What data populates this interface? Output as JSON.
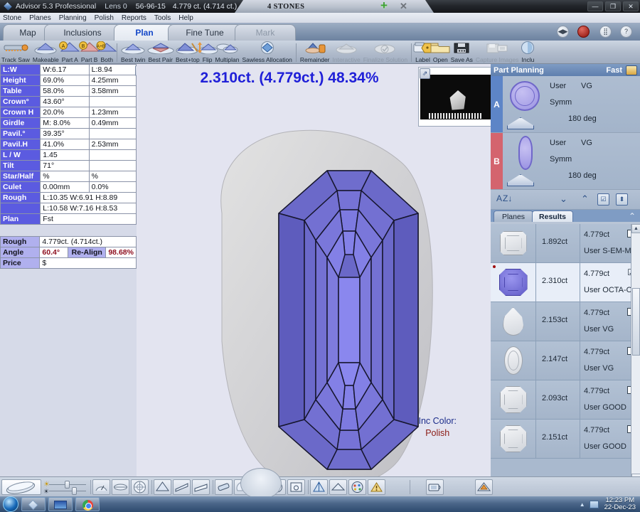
{
  "window": {
    "app_title": "Advisor 5.3 Professional",
    "lens": "Lens 0",
    "serial": "56-96-15",
    "carat_summary": "4.779 ct. (4.714 ct.)",
    "stone_tab": "4 STONES",
    "add_icon": "plus-icon",
    "close_tab_icon": "close-icon",
    "minimize": "—",
    "maximize": "❐",
    "close": "✕"
  },
  "menu": [
    "Stone",
    "Planes",
    "Planning",
    "Polish",
    "Reports",
    "Tools",
    "Help"
  ],
  "tabs": [
    {
      "label": "Map",
      "active": false,
      "dim": false
    },
    {
      "label": "Inclusions",
      "active": false,
      "dim": false
    },
    {
      "label": "Plan",
      "active": true,
      "dim": false
    },
    {
      "label": "Fine Tune",
      "active": false,
      "dim": false
    },
    {
      "label": "Mark",
      "active": false,
      "dim": true
    }
  ],
  "tabstrip_buttons": [
    {
      "name": "nav-left-right-button",
      "glyph": "◀▶"
    },
    {
      "name": "record-button",
      "glyph": ""
    },
    {
      "name": "grid-view-button",
      "glyph": "⣿"
    },
    {
      "name": "help-button",
      "glyph": "?"
    }
  ],
  "toolbar": [
    {
      "label": "Track Saw",
      "icon": "saw-icon",
      "disabled": false
    },
    {
      "label": "Makeable",
      "icon": "makeable-icon",
      "disabled": false
    },
    {
      "label": "Part A",
      "icon": "part-a-icon",
      "disabled": false
    },
    {
      "label": "Part B",
      "icon": "part-b-icon",
      "disabled": false
    },
    {
      "label": "Both",
      "icon": "both-icon",
      "disabled": false
    },
    {
      "label": "Best twin",
      "icon": "best-twin-icon",
      "disabled": false
    },
    {
      "label": "Best Pair",
      "icon": "best-pair-icon",
      "disabled": false
    },
    {
      "label": "Best+top",
      "icon": "best-top-icon",
      "disabled": false
    },
    {
      "label": "Flip",
      "icon": "flip-icon",
      "disabled": false
    },
    {
      "label": "Multiplan",
      "icon": "multiplan-icon",
      "disabled": false
    },
    {
      "label": "Sawless Allocation",
      "icon": "sawless-allocation-icon",
      "disabled": false
    },
    {
      "label": "Remainder",
      "icon": "remainder-icon",
      "disabled": false
    },
    {
      "label": "Interactive",
      "icon": "interactive-icon",
      "disabled": true
    },
    {
      "label": "Finalize Solution",
      "icon": "finalize-solution-icon",
      "disabled": true
    },
    {
      "label": "Label",
      "icon": "label-icon",
      "disabled": false
    },
    {
      "label": "Open",
      "icon": "folder-open-icon",
      "disabled": false
    },
    {
      "label": "Save As",
      "icon": "floppy-save-icon",
      "disabled": false
    },
    {
      "label": "Capture Images",
      "icon": "capture-images-icon",
      "disabled": true
    },
    {
      "label": "Inclu",
      "icon": "inclusions-icon",
      "disabled": false
    }
  ],
  "params": {
    "expand_icon": "expand-icon",
    "rows": [
      {
        "label": "L:W",
        "v1": "W:6.17",
        "v2": "L:8.94"
      },
      {
        "label": "Height",
        "v1": "69.0%",
        "v2": "4.25mm"
      },
      {
        "label": "Table",
        "v1": "58.0%",
        "v2": "3.58mm"
      },
      {
        "label": "Crown°",
        "v1": "43.60°",
        "v2": ""
      },
      {
        "label": "Crown H",
        "v1": "20.0%",
        "v2": "1.23mm"
      },
      {
        "label": "Girdle",
        "v1": "M: 8.0%",
        "v2": "0.49mm"
      },
      {
        "label": "Pavil.°",
        "v1": "39.35°",
        "v2": ""
      },
      {
        "label": "Pavil.H",
        "v1": "41.0%",
        "v2": "2.53mm"
      },
      {
        "label": "L / W",
        "v1": "1.45",
        "v2": ""
      },
      {
        "label": "Tilt",
        "v1": "71°",
        "v2": ""
      },
      {
        "label": "Star/Half",
        "v1": "%",
        "v2": "%"
      },
      {
        "label": "Culet",
        "v1": "0.00mm",
        "v2": "0.0%"
      }
    ],
    "rough_label": "Rough",
    "rough_line1": "L:10.35 W:6.91 H:8.89",
    "rough_line2": "L:10.58 W:7.16 H:8.53",
    "plan_label": "Plan",
    "plan_value": "Fst"
  },
  "rough_table": {
    "rough_label": "Rough",
    "rough_value": "4.779ct. (4.714ct.)",
    "angle_label": "Angle",
    "angle_value": "60.4°",
    "realign_label": "Re-Align",
    "realign_value": "98.68%",
    "price_label": "Price",
    "price_value": "$"
  },
  "viewport": {
    "headline": "2.310ct. (4.779ct.) 48.34%",
    "inc_color_label": "Inc Color:",
    "polish_label": "Polish",
    "thumbnail": {
      "expand_icon": "expand-icon",
      "photo_name": "rough-stone-photo",
      "ruler_name": "scale-ruler"
    },
    "model_name": "diamond-3d-model"
  },
  "part_planning": {
    "title": "Part Planning",
    "mode": "Fast",
    "mode_button_icon": "fast-mode-icon",
    "parts": [
      {
        "tag": "A",
        "shape_icon": "round-brilliant-icon",
        "cut_icon": "pavilion-profile-icon",
        "user": "User",
        "grade": "VG",
        "symm": "Symm",
        "deg": "180 deg"
      },
      {
        "tag": "B",
        "shape_icon": "marquise-icon",
        "cut_icon": "pavilion-profile-icon",
        "user": "User",
        "grade": "VG",
        "symm": "Symm",
        "deg": "180 deg"
      }
    ],
    "sort_controls": [
      {
        "name": "sort-az-button",
        "glyph": "A↓"
      },
      {
        "name": "move-down-button",
        "glyph": "⌄"
      },
      {
        "name": "move-up-button",
        "glyph": "⌃"
      },
      {
        "name": "check-list-button",
        "glyph": "☑"
      },
      {
        "name": "select-all-button",
        "glyph": "⬍"
      }
    ],
    "result_tabs": [
      {
        "label": "Planes",
        "active": false
      },
      {
        "label": "Results",
        "active": true
      }
    ],
    "collapse_icon": "chevron-up-icon"
  },
  "results": {
    "scrollbar": {
      "up_icon": "scroll-up-arrow",
      "down_icon": "scroll-down-arrow"
    },
    "rows": [
      {
        "shape": "ms-emerald",
        "shape_name": "emerald-cut-icon",
        "carat": "1.892ct",
        "rough": "4.779ct",
        "grade": "User S-EM-MU",
        "checked": false,
        "selected": false
      },
      {
        "shape": "ms-octa-blue",
        "shape_name": "octagon-cut-icon",
        "carat": "2.310ct",
        "rough": "4.779ct",
        "grade": "User OCTA-OL",
        "checked": true,
        "selected": true
      },
      {
        "shape": "ms-pear",
        "shape_name": "pear-cut-icon",
        "carat": "2.153ct",
        "rough": "4.779ct",
        "grade": "User VG",
        "checked": false,
        "selected": false
      },
      {
        "shape": "ms-oval",
        "shape_name": "oval-cut-icon",
        "carat": "2.147ct",
        "rough": "4.779ct",
        "grade": "User VG",
        "checked": false,
        "selected": false
      },
      {
        "shape": "ms-asscher",
        "shape_name": "asscher-cut-icon",
        "carat": "2.093ct",
        "rough": "4.779ct",
        "grade": "User GOOD",
        "checked": false,
        "selected": false
      },
      {
        "shape": "ms-asscher",
        "shape_name": "asscher-cut-icon",
        "carat": "2.151ct",
        "rough": "4.779ct",
        "grade": "User GOOD",
        "checked": false,
        "selected": false
      }
    ]
  },
  "bottom_toolbar": [
    {
      "name": "view-mode-button",
      "icon": "lens-view-icon",
      "active": true
    },
    {
      "name": "brightness-slider",
      "icon": "brightness-slider"
    },
    {
      "name": "gauge-button",
      "icon": "gauge-icon"
    },
    {
      "name": "girdle-view-button",
      "icon": "girdle-icon"
    },
    {
      "name": "facet-pattern-button",
      "icon": "facet-pattern-icon"
    },
    {
      "name": "crown-view-button",
      "icon": "crown-icon"
    },
    {
      "name": "side-view-button",
      "icon": "side-view-icon"
    },
    {
      "name": "tilt-view-button",
      "icon": "tilt-view-icon"
    },
    {
      "name": "measure-button",
      "icon": "ruler-icon"
    },
    {
      "name": "rotate-nav-wheel",
      "icon": "rotate-wheel-icon"
    },
    {
      "name": "zoom-in-button",
      "icon": "plus-icon"
    },
    {
      "name": "zoom-fit-button",
      "icon": "fit-box-icon"
    },
    {
      "name": "cut-preview-button",
      "icon": "cut-preview-icon"
    },
    {
      "name": "pavilion-button",
      "icon": "pavilion-icon"
    },
    {
      "name": "color-palette-button",
      "icon": "palette-icon"
    },
    {
      "name": "warning-button",
      "icon": "warning-icon"
    },
    {
      "name": "screenshot-button",
      "icon": "camera-icon"
    },
    {
      "name": "home-view-button",
      "icon": "home-view-icon"
    }
  ],
  "taskbar": {
    "start_icon": "windows-start-orb",
    "apps": [
      {
        "name": "taskbar-app-advisor",
        "icon": "diamond-icon"
      },
      {
        "name": "taskbar-app-scanner",
        "icon": "monitor-icon"
      },
      {
        "name": "taskbar-app-chrome",
        "icon": "chrome-icon"
      }
    ],
    "tray_arrow_icon": "show-hidden-icons-arrow",
    "network_icon": "network-icon",
    "time": "12:23 PM",
    "date": "22-Dec-23"
  },
  "colors": {
    "accent_blue": "#2020d8",
    "header_purple": "#5b5be0",
    "panel_blue": "#5f7fae",
    "red_tag": "#d4646e",
    "blue_tag": "#5d85c7",
    "polish_red": "#8b1a14"
  }
}
